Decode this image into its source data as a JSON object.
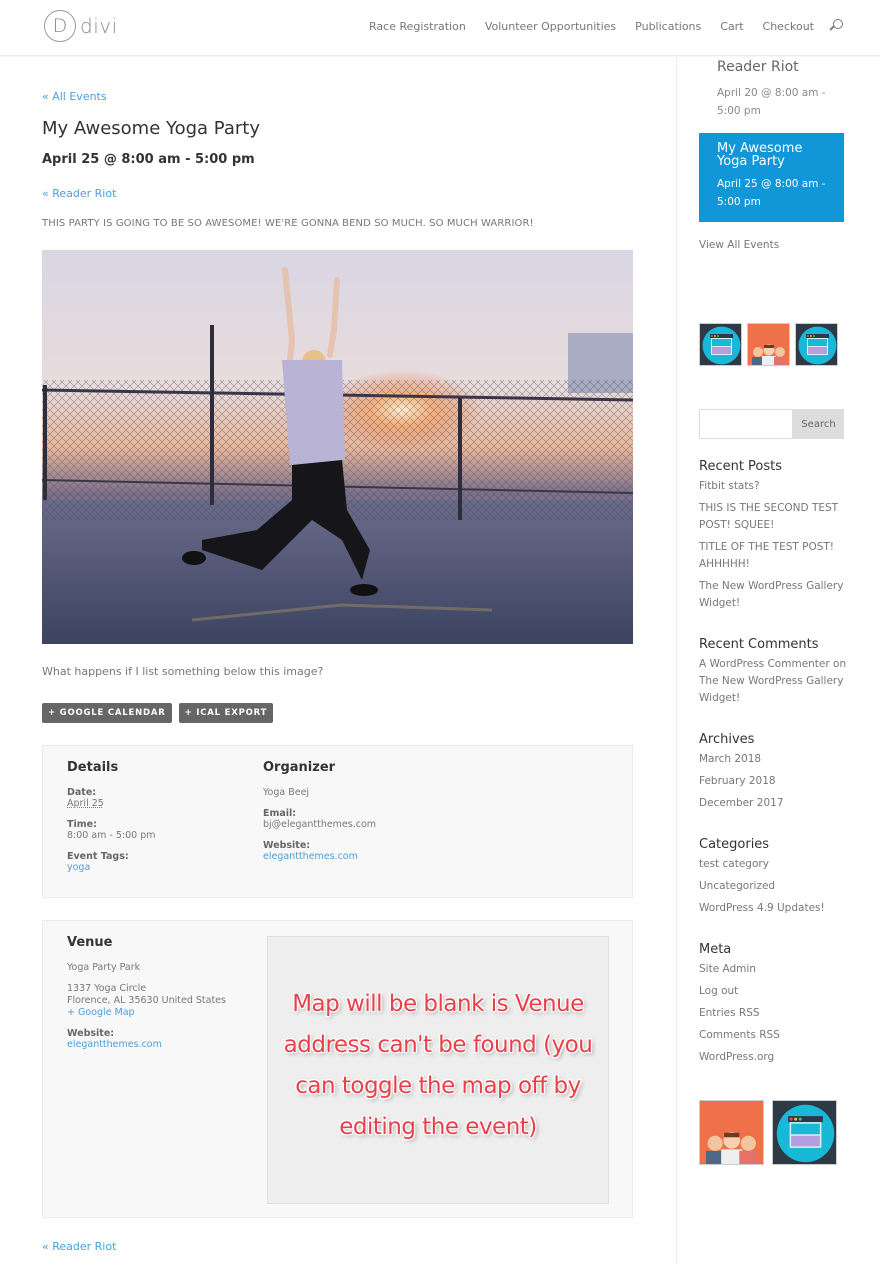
{
  "header": {
    "logo_letter": "D",
    "logo_text": "divi",
    "nav": [
      "Race Registration",
      "Volunteer Opportunities",
      "Publications",
      "Cart",
      "Checkout"
    ]
  },
  "event": {
    "back_link": "« All Events",
    "title": "My Awesome Yoga Party",
    "date": "April 25 @ 8:00 am - 5:00 pm",
    "prev_link": "« Reader Riot",
    "description": "THIS PARTY IS GOING TO BE SO AWESOME! WE'RE GONNA BEND SO MUCH. SO MUCH WARRIOR!",
    "below_image_text": "What happens if I list something below this image?",
    "buttons": [
      "+ Google Calendar",
      "+ iCal Export"
    ],
    "footer_link": "« Reader Riot"
  },
  "details": {
    "heading": "Details",
    "date_label": "Date:",
    "date_value": "April 25",
    "time_label": "Time:",
    "time_value": "8:00 am - 5:00 pm",
    "tags_label": "Event Tags:",
    "tags_value": "yoga"
  },
  "organizer": {
    "heading": "Organizer",
    "name": "Yoga Beej",
    "email_label": "Email:",
    "email_value": "bj@elegantthemes.com",
    "website_label": "Website:",
    "website_value": "elegantthemes.com"
  },
  "venue": {
    "heading": "Venue",
    "name": "Yoga Party Park",
    "address_line1": "1337 Yoga Circle",
    "address_line2": "Florence, AL 35630 United States",
    "map_link": "+ Google Map",
    "website_label": "Website:",
    "website_value": "elegantthemes.com",
    "map_note": "Map will be blank is Venue address can't be found (you can toggle the map off by editing the event)"
  },
  "sidebar": {
    "upcoming": {
      "title": "Reader Riot",
      "date": "April 20 @ 8:00 am - 5:00 pm"
    },
    "highlight": {
      "title": "My Awesome Yoga Party",
      "date": "April 25 @ 8:00 am - 5:00 pm",
      "bg_color": "#1196d8"
    },
    "view_all": "View All Events",
    "search": {
      "placeholder": "",
      "button": "Search"
    },
    "recent_posts": {
      "title": "Recent Posts",
      "items": [
        "Fitbit stats?",
        "THIS IS THE SECOND TEST POST! SQUEE!",
        "TITLE OF THE TEST POST! AHHHHH!",
        "The New WordPress Gallery Widget!"
      ]
    },
    "recent_comments": {
      "title": "Recent Comments",
      "items": [
        "A WordPress Commenter on The New WordPress Gallery Widget!"
      ]
    },
    "archives": {
      "title": "Archives",
      "items": [
        "March 2018",
        "February 2018",
        "December 2017"
      ]
    },
    "categories": {
      "title": "Categories",
      "items": [
        "test category",
        "Uncategorized",
        "WordPress 4.9 Updates!"
      ]
    },
    "meta": {
      "title": "Meta",
      "items": [
        "Site Admin",
        "Log out",
        "Entries RSS",
        "Comments RSS",
        "WordPress.org"
      ]
    }
  },
  "colors": {
    "link": "#4a9fd8",
    "accent": "#1196d8",
    "button_bg": "#666666",
    "map_note": "#e8404a"
  }
}
